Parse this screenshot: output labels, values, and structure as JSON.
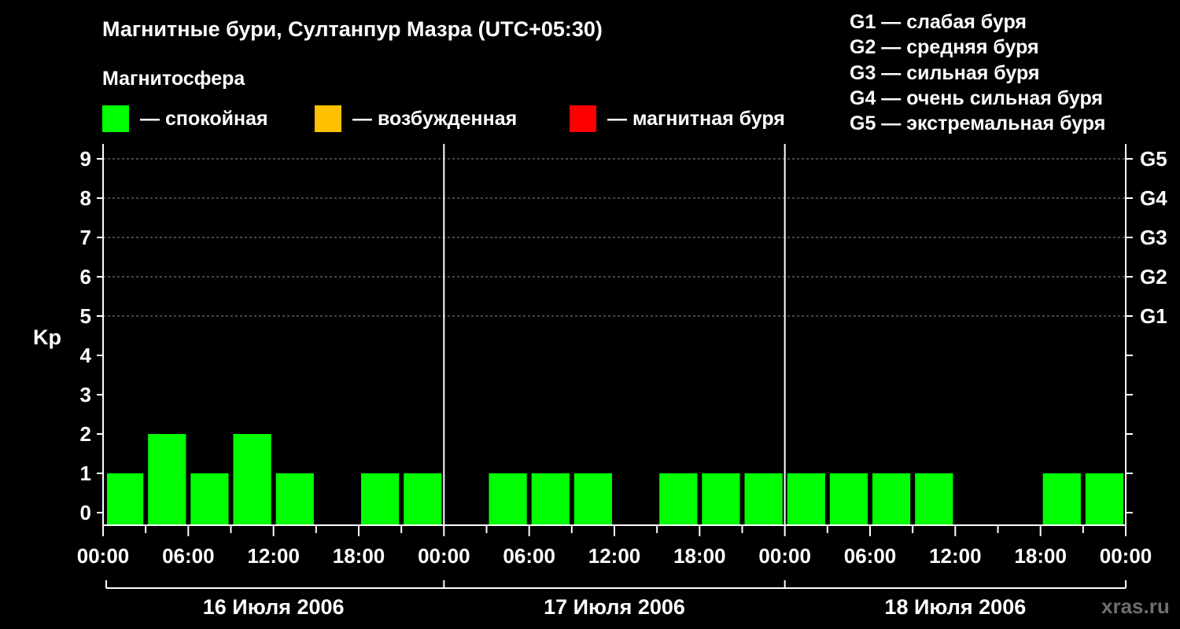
{
  "title": "Магнитные бури, Султанпур Мазра (UTC+05:30)",
  "subtitle": "Магнитосфера",
  "legend": [
    {
      "label": "— спокойная",
      "color": "#00ff00"
    },
    {
      "label": "— возбужденная",
      "color": "#ffc000"
    },
    {
      "label": "— магнитная буря",
      "color": "#ff0000"
    }
  ],
  "storm_scale": [
    "G1 — слабая буря",
    "G2 — средняя буря",
    "G3 — сильная буря",
    "G4 — очень сильная буря",
    "G5 — экстремальная буря"
  ],
  "watermark": "xras.ru",
  "chart_data": {
    "type": "bar",
    "ylabel": "Kp",
    "ylim": [
      0,
      9
    ],
    "y_ticks": [
      "0",
      "1",
      "2",
      "3",
      "4",
      "5",
      "6",
      "7",
      "8",
      "9"
    ],
    "right_ticks": [
      {
        "kp": 5,
        "label": "G1"
      },
      {
        "kp": 6,
        "label": "G2"
      },
      {
        "kp": 7,
        "label": "G3"
      },
      {
        "kp": 8,
        "label": "G4"
      },
      {
        "kp": 9,
        "label": "G5"
      }
    ],
    "x_tick_labels": [
      "00:00",
      "06:00",
      "12:00",
      "18:00",
      "00:00",
      "06:00",
      "12:00",
      "18:00",
      "00:00",
      "06:00",
      "12:00",
      "18:00",
      "00:00"
    ],
    "days": [
      "16 Июля 2006",
      "17 Июля 2006",
      "18 Июля 2006"
    ],
    "grid": "dashed at Kp 5–9",
    "series": [
      {
        "values": [
          {
            "day": "16 Июля 2006",
            "time": "00:00",
            "kp": 1,
            "color": "#00ff00"
          },
          {
            "day": "16 Июля 2006",
            "time": "03:00",
            "kp": 2,
            "color": "#00ff00"
          },
          {
            "day": "16 Июля 2006",
            "time": "06:00",
            "kp": 1,
            "color": "#00ff00"
          },
          {
            "day": "16 Июля 2006",
            "time": "09:00",
            "kp": 2,
            "color": "#00ff00"
          },
          {
            "day": "16 Июля 2006",
            "time": "12:00",
            "kp": 1,
            "color": "#00ff00"
          },
          {
            "day": "16 Июля 2006",
            "time": "15:00",
            "kp": 0,
            "color": "#00ff00"
          },
          {
            "day": "16 Июля 2006",
            "time": "18:00",
            "kp": 1,
            "color": "#00ff00"
          },
          {
            "day": "16 Июля 2006",
            "time": "21:00",
            "kp": 1,
            "color": "#00ff00"
          },
          {
            "day": "17 Июля 2006",
            "time": "00:00",
            "kp": 0,
            "color": "#00ff00"
          },
          {
            "day": "17 Июля 2006",
            "time": "03:00",
            "kp": 1,
            "color": "#00ff00"
          },
          {
            "day": "17 Июля 2006",
            "time": "06:00",
            "kp": 1,
            "color": "#00ff00"
          },
          {
            "day": "17 Июля 2006",
            "time": "09:00",
            "kp": 1,
            "color": "#00ff00"
          },
          {
            "day": "17 Июля 2006",
            "time": "12:00",
            "kp": 0,
            "color": "#00ff00"
          },
          {
            "day": "17 Июля 2006",
            "time": "15:00",
            "kp": 1,
            "color": "#00ff00"
          },
          {
            "day": "17 Июля 2006",
            "time": "18:00",
            "kp": 1,
            "color": "#00ff00"
          },
          {
            "day": "17 Июля 2006",
            "time": "21:00",
            "kp": 1,
            "color": "#00ff00"
          },
          {
            "day": "18 Июля 2006",
            "time": "00:00",
            "kp": 1,
            "color": "#00ff00"
          },
          {
            "day": "18 Июля 2006",
            "time": "03:00",
            "kp": 1,
            "color": "#00ff00"
          },
          {
            "day": "18 Июля 2006",
            "time": "06:00",
            "kp": 1,
            "color": "#00ff00"
          },
          {
            "day": "18 Июля 2006",
            "time": "09:00",
            "kp": 1,
            "color": "#00ff00"
          },
          {
            "day": "18 Июля 2006",
            "time": "12:00",
            "kp": 0,
            "color": "#00ff00"
          },
          {
            "day": "18 Июля 2006",
            "time": "15:00",
            "kp": 0,
            "color": "#00ff00"
          },
          {
            "day": "18 Июля 2006",
            "time": "18:00",
            "kp": 1,
            "color": "#00ff00"
          },
          {
            "day": "18 Июля 2006",
            "time": "21:00",
            "kp": 1,
            "color": "#00ff00"
          }
        ]
      }
    ]
  }
}
